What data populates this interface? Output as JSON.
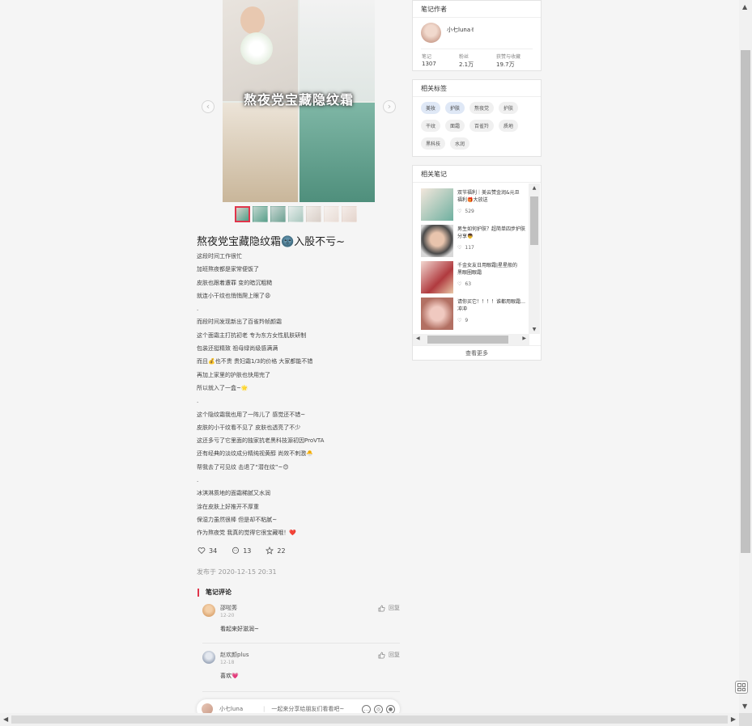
{
  "note": {
    "hero_overlay_title": "熬夜党宝藏隐纹霜",
    "title": "熬夜党宝藏隐纹霜🌚入股不亏~",
    "body_lines": [
      "这段时间工作很忙",
      "加班熬夜都是家常便饭了",
      "皮肤也跟着遭罪 变的暗沉粗糙",
      "就连小干纹也悄悄爬上眼了😩",
      ".",
      "而段时间发现新出了百雀羚帧颜霜",
      "这个面霜主打抗初老 专为东方女性肌肤研制",
      "包装还挺精致 祖母绿尚级感满满",
      "而且💰也不贵 贵妇霜1/3的价格 大家都能不错",
      "再加上家里的护肤也快用完了",
      "所以就入了一盒~🌟",
      ".",
      "这个隐纹霜我也用了一阵儿了 感觉还不错~",
      "皮肤的小干纹看不见了 皮肤也透亮了不少",
      "这还多亏了它里面的独家抗老黑科技源初因ProVTA",
      "还有经典的淡纹成分精纯视黄醇 尚效不刺激🐣",
      "帮我去了可见纹 击退了“潜在纹”~😊",
      ".",
      "冰淇淋质地的面霜稀腻又水润",
      "涂在皮肤上好推开不厚重",
      "保湿力虽然很棒 但是却不粘腻~",
      "作为熬夜党 我真的觉得它很宝藏哦！❤️"
    ],
    "likes": "34",
    "comments": "13",
    "collects": "22",
    "published": "发布于 2020-12-15 20:31"
  },
  "comments_section": {
    "heading": "笔记评论",
    "items": [
      {
        "name": "邵啦莠",
        "date": "12-20",
        "text": "看起来好滋润~",
        "reply": "回复"
      },
      {
        "name": "赵欢颜plus",
        "date": "12-18",
        "text": "喜欢💗",
        "reply": "回复"
      }
    ]
  },
  "bottom_bar": {
    "user": "小七luna",
    "placeholder": "一起来分享给朋友们看看吧~"
  },
  "author_card": {
    "heading": "笔记作者",
    "name": "小七luna✌",
    "stats": [
      {
        "label": "笔记",
        "value": "1307"
      },
      {
        "label": "粉丝",
        "value": "2.1万"
      },
      {
        "label": "获赞与收藏",
        "value": "19.7万"
      }
    ]
  },
  "tags_card": {
    "heading": "相关标签",
    "tags": [
      "美妆",
      "护肤",
      "熬夜党",
      "护肤",
      "干纹",
      "面霜",
      "百雀羚",
      "质地",
      "黑科技",
      "水润"
    ]
  },
  "related_card": {
    "heading": "相关笔记",
    "items": [
      {
        "title1": "双节福利｜美云赞金润&元旦",
        "title2": "福利🎁大放送",
        "likes": "529"
      },
      {
        "title1": "男生如何护肤？超简单四步护肤",
        "title2": "分享👦",
        "likes": "117"
      },
      {
        "title1": "千金女友日用眼霜|星星般的",
        "title2": "黑眼圈眼霜",
        "likes": "63"
      },
      {
        "title1": "请你买它！！！！谁都用眼霜…",
        "title2": "冲冲",
        "likes": "9"
      }
    ],
    "more": "查看更多"
  },
  "colors": {
    "accent": "#e0354b",
    "tag_highlight": "#dfe8f6",
    "heart": "#e0354b"
  }
}
